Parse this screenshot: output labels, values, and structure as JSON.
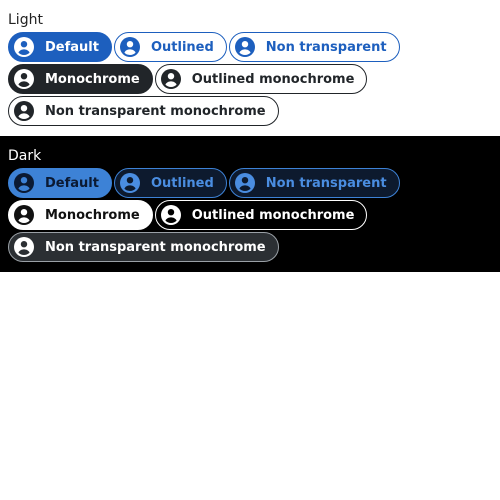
{
  "light": {
    "title": "Light",
    "chips": [
      {
        "label": "Default",
        "variant": "default"
      },
      {
        "label": "Outlined",
        "variant": "outlined"
      },
      {
        "label": "Non transparent",
        "variant": "nontransparent"
      },
      {
        "label": "Monochrome",
        "variant": "mono"
      },
      {
        "label": "Outlined monochrome",
        "variant": "outlined-mono"
      },
      {
        "label": "Non transparent monochrome",
        "variant": "nontransparent-mono"
      }
    ]
  },
  "dark": {
    "title": "Dark",
    "chips": [
      {
        "label": "Default",
        "variant": "default"
      },
      {
        "label": "Outlined",
        "variant": "outlined"
      },
      {
        "label": "Non transparent",
        "variant": "nontransparent"
      },
      {
        "label": "Monochrome",
        "variant": "mono"
      },
      {
        "label": "Outlined monochrome",
        "variant": "outlined-mono"
      },
      {
        "label": "Non transparent monochrome",
        "variant": "nontransparent-mono"
      }
    ]
  },
  "icons": {
    "chip_icon": "account-circle-icon"
  },
  "colors": {
    "primary": "#1d5fbe",
    "primary_dark": "#3d82d6",
    "mono": "#212529"
  }
}
